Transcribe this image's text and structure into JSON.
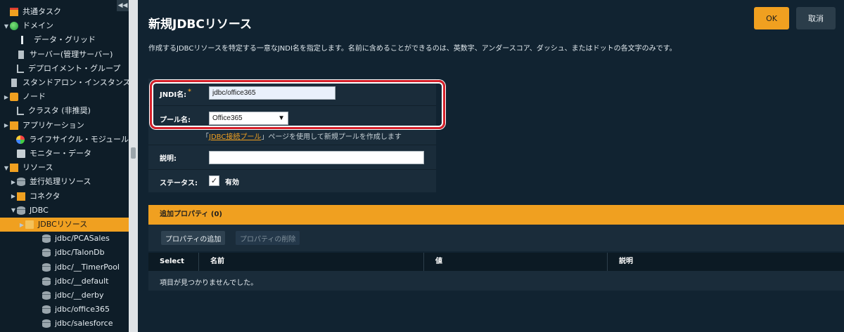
{
  "sidebar": {
    "collapse_icon": "double-chevron-left",
    "items": [
      {
        "label": "共通タスク",
        "icon": "calendar-icon",
        "twisty": ""
      },
      {
        "label": "ドメイン",
        "icon": "globe-icon",
        "twisty": "▼"
      },
      {
        "label": "データ・グリッド",
        "icon": "grid-icon",
        "twisty": ""
      },
      {
        "label": "サーバー(管理サーバー)",
        "icon": "server-icon",
        "twisty": ""
      },
      {
        "label": "デプロイメント・グループ",
        "icon": "tree-icon",
        "twisty": ""
      },
      {
        "label": "スタンドアロン・インスタンス",
        "icon": "server-icon",
        "twisty": ""
      },
      {
        "label": "ノード",
        "icon": "monitor-icon",
        "twisty": "▶"
      },
      {
        "label": "クラスタ (非推奨)",
        "icon": "tree-icon",
        "twisty": ""
      },
      {
        "label": "アプリケーション",
        "icon": "apps-icon",
        "twisty": "▶"
      },
      {
        "label": "ライフサイクル・モジュール",
        "icon": "lifecycle-icon",
        "twisty": ""
      },
      {
        "label": "モニター・データ",
        "icon": "monitor-data-icon",
        "twisty": ""
      },
      {
        "label": "リソース",
        "icon": "box-icon",
        "twisty": "▼"
      },
      {
        "label": "並行処理リソース",
        "icon": "database-icon",
        "twisty": "▶"
      },
      {
        "label": "コネクタ",
        "icon": "box-icon",
        "twisty": "▶"
      },
      {
        "label": "JDBC",
        "icon": "database-icon",
        "twisty": "▼"
      },
      {
        "label": "JDBCリソース",
        "icon": "folder-icon",
        "twisty": "▶"
      },
      {
        "label": "jdbc/PCASales",
        "icon": "database-icon",
        "twisty": ""
      },
      {
        "label": "jdbc/TalonDb",
        "icon": "database-icon",
        "twisty": ""
      },
      {
        "label": "jdbc/__TimerPool",
        "icon": "database-icon",
        "twisty": ""
      },
      {
        "label": "jdbc/__default",
        "icon": "database-icon",
        "twisty": ""
      },
      {
        "label": "jdbc/__derby",
        "icon": "database-icon",
        "twisty": ""
      },
      {
        "label": "jdbc/office365",
        "icon": "database-icon",
        "twisty": ""
      },
      {
        "label": "jdbc/salesforce",
        "icon": "database-icon",
        "twisty": ""
      }
    ],
    "selected_label": "JDBCリソース"
  },
  "header": {
    "title": "新規JDBCリソース",
    "description": "作成するJDBCリソースを特定する一意なJNDI名を指定します。名前に含めることができるのは、英数字、アンダースコア、ダッシュ、またはドットの各文字のみです。",
    "ok_label": "OK",
    "cancel_label": "取消"
  },
  "form": {
    "jndi_label": "JNDI名:",
    "required_mark": "*",
    "jndi_value": "jdbc/office365",
    "pool_label": "プール名:",
    "pool_value": "Office365",
    "pool_hint_prefix": "「",
    "pool_hint_link": "JDBC接続プール",
    "pool_hint_suffix": "」ページを使用して新規プールを作成します",
    "desc_label": "説明:",
    "desc_value": "",
    "status_label": "ステータス:",
    "status_checked": true,
    "status_value": "有効"
  },
  "properties": {
    "header": "追加プロパティ (0)",
    "add_label": "プロパティの追加",
    "delete_label": "プロパティの削除",
    "columns": [
      "Select",
      "名前",
      "値",
      "説明"
    ],
    "empty_message": "項目が見つかりませんでした。"
  },
  "colors": {
    "accent": "#f0a020",
    "background": "#112331",
    "panel": "#1a2c3a",
    "highlight": "#d6202a"
  }
}
